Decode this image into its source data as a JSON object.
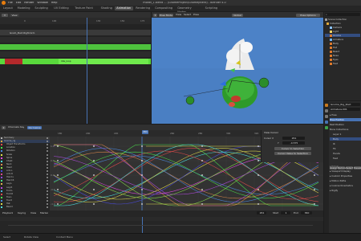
{
  "window": {
    "title": "model_1.blend ... (GnomeProject/GnomeJitterd) - Blender 4.0"
  },
  "top_menu": [
    "File",
    "Edit",
    "Render",
    "Window",
    "Help"
  ],
  "workspaces": [
    "Layout",
    "Modeling",
    "Sculpting",
    "UV Editing",
    "Texture Paint",
    "Shading",
    "Animation",
    "Rendering",
    "Compositing",
    "Geometry Nodes",
    "Scripting"
  ],
  "active_workspace": "Animation",
  "nla": {
    "ruler_ticks": [
      "0",
      "100",
      "130",
      "150",
      "175"
    ],
    "current_frame": "",
    "tracks": [
      {
        "label": "Gnom_Push Right Arm",
        "color": "#3a3a3a"
      },
      {
        "label": "",
        "color": "#2c2c2c"
      },
      {
        "label": "",
        "color": "#4ec23d"
      },
      {
        "label": "",
        "color": "#2c2c2c"
      },
      {
        "label": "Run_loop",
        "strip": "Idle_loop",
        "color": "#59d93c"
      }
    ]
  },
  "viewport": {
    "mode": "Pose Mode",
    "view": "View",
    "select": "Select",
    "pose": "Pose",
    "global": "Global",
    "options": "Pose Options"
  },
  "outliner": {
    "items": [
      "Scene Collection",
      "Collection",
      "Camera",
      "Light",
      "Gnome",
      "Armature",
      "Body",
      "Hat",
      "Beard",
      "Nose",
      "Eyes",
      "Feet"
    ]
  },
  "properties": {
    "object": "Gnome_Rig_Root",
    "data": "Armature.001",
    "sections": [
      "Pose",
      "Pose Position",
      "Rest Position",
      "Bone Collections",
      "Layer 1",
      "Body",
      "IK",
      "FK",
      "Hands",
      "Feet",
      "Group",
      "Viewport Display",
      "Custom Properties",
      "Motion Paths",
      "Inverse Kinematics",
      "Rigify"
    ],
    "buttons": [
      "Assign",
      "Remove",
      "Select",
      "Deselect"
    ]
  },
  "graph_editor": {
    "tabs": [
      "Channels",
      "Key",
      "Normalize"
    ],
    "ruler_ticks": [
      "180",
      "200",
      "220",
      "240",
      "260",
      "280",
      "300",
      "320",
      "340"
    ],
    "current_frame": "261",
    "y_labels": [
      "1.0",
      "0.5",
      "0.0",
      "-0.5",
      "-1.0"
    ],
    "channels": [
      "Summary",
      "Gnome_rig",
      "Object Transforms",
      "Location",
      "Rotation",
      "Scale",
      "Spine",
      "Chest",
      "Neck",
      "Head",
      "Arm.L",
      "Arm.R",
      "Hand.L",
      "Hand.R",
      "Leg.L",
      "Leg.R",
      "Foot.L",
      "Foot.R",
      "Toe.L",
      "Toe.R",
      "Hat",
      "Beard"
    ],
    "view_cursor": {
      "title": "View Cursor",
      "frame_label": "Cursor X",
      "frame_value": "261",
      "value_label": "Y",
      "value_value": "-0.575",
      "btn1": "Cursor to Selection",
      "btn2": "Cursor Value to Selection"
    }
  },
  "timeline": {
    "playback": "Playback",
    "keying": "Keying",
    "view": "View",
    "marker": "Marker",
    "start_label": "Start",
    "start": "1",
    "end_label": "End",
    "end": "360",
    "frame": "261"
  },
  "status": {
    "left": "Select",
    "middle": "Rotate View",
    "right": "Context Menu"
  },
  "colors": {
    "accent": "#4772b3",
    "nla_green": "#59d93c",
    "viewport_blue": "#4c82c7"
  }
}
